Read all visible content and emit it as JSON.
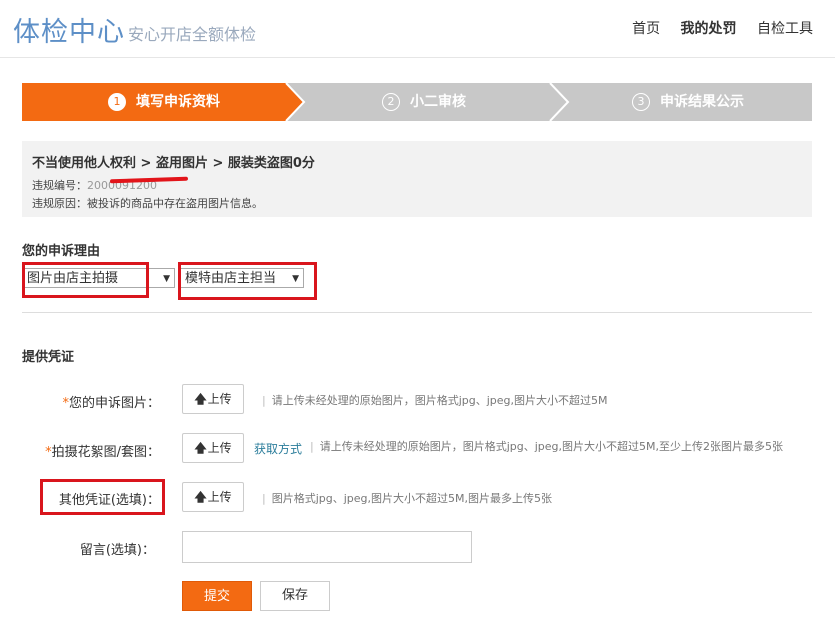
{
  "header": {
    "logo": "体检中心",
    "slogan": "安心开店全额体检",
    "nav": [
      "首页",
      "我的处罚",
      "自检工具"
    ]
  },
  "steps": [
    {
      "num": "1",
      "label": "填写申诉资料"
    },
    {
      "num": "2",
      "label": "小二审核"
    },
    {
      "num": "3",
      "label": "申诉结果公示"
    }
  ],
  "violation": {
    "path": "不当使用他人权利 > 盗用图片 > 服装类盗图0分",
    "id_label": "违规编号：",
    "id_value": "2000091200",
    "reason_label": "违规原因：",
    "reason_value": "被投诉的商品中存在盗用图片信息。"
  },
  "appeal_reason": {
    "title": "您的申诉理由",
    "select1": "图片由店主拍摄",
    "select2": "模特由店主担当"
  },
  "evidence": {
    "title": "提供凭证",
    "upload_label": "上传",
    "items": [
      {
        "label": "您的申诉图片：",
        "hint": "请上传未经处理的原始图片，图片格式jpg、jpeg,图片大小不超过5M"
      },
      {
        "label": "拍摄花絮图/套图：",
        "link": "获取方式",
        "hint": "请上传未经处理的原始图片，图片格式jpg、jpeg,图片大小不超过5M,至少上传2张图片最多5张"
      },
      {
        "label": "其他凭证(选填)：",
        "hint": "图片格式jpg、jpeg,图片大小不超过5M,图片最多上传5张"
      }
    ],
    "message_label": "留言(选填)："
  },
  "buttons": {
    "submit": "提交",
    "save": "保存"
  },
  "colors": {
    "accent": "#f36a12",
    "step_inactive": "#c8c8c8",
    "annotation_red": "#d9151d",
    "logo_blue": "#5d8fc7"
  }
}
